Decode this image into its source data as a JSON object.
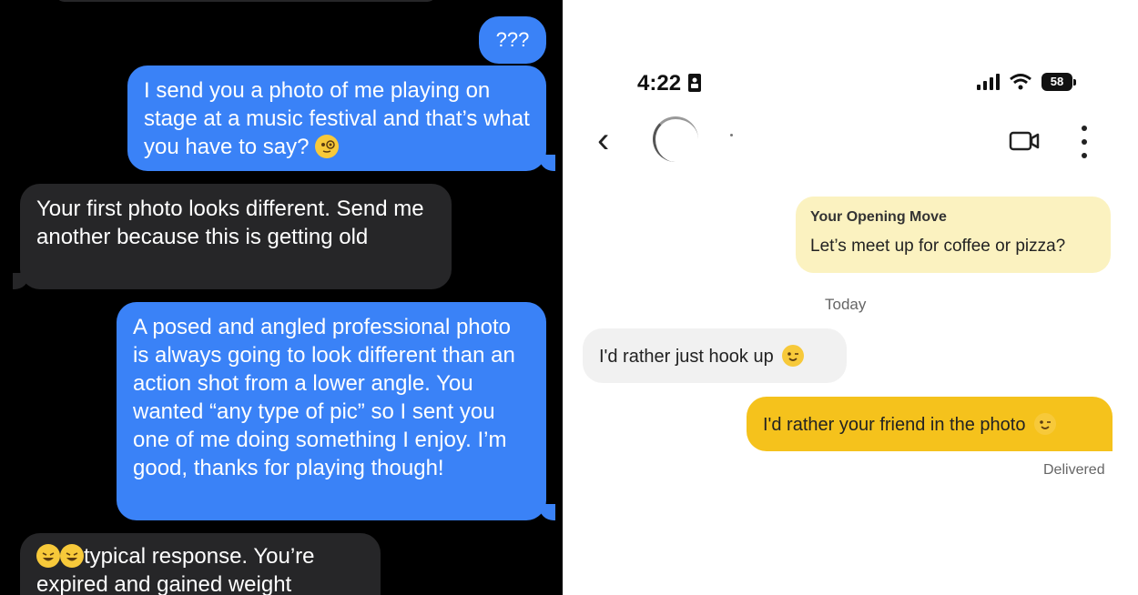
{
  "left_chat": {
    "messages": [
      {
        "from": "me",
        "text": "???"
      },
      {
        "from": "me",
        "text": "I send you a photo of me playing on stage at a music festival and that’s what you have to say?"
      },
      {
        "from": "them",
        "text": "Your first photo looks different. Send me another because this is getting old"
      },
      {
        "from": "me",
        "text": "A posed and angled professional photo is always going to look different than an action shot from a lower angle. You wanted “any type of pic” so I sent you one of me doing something I enjoy. I’m good, thanks for playing though!"
      },
      {
        "from": "them",
        "text": "typical response. You’re expired and gained weight"
      }
    ],
    "colors": {
      "sent": "#3a82f7",
      "received": "#262628",
      "background": "#000000"
    }
  },
  "right_chat": {
    "status_bar": {
      "time": "4:22",
      "battery": "58"
    },
    "opening_move": {
      "title": "Your Opening Move",
      "message": "Let’s meet up for coffee or pizza?"
    },
    "date_label": "Today",
    "incoming": "I'd rather just hook up",
    "outgoing": "I'd rather your friend in the photo",
    "delivery_status": "Delivered",
    "colors": {
      "outgoing": "#f5c21c",
      "opening_bg": "#fbf2c0",
      "incoming_bg": "#f1f1f1"
    }
  }
}
